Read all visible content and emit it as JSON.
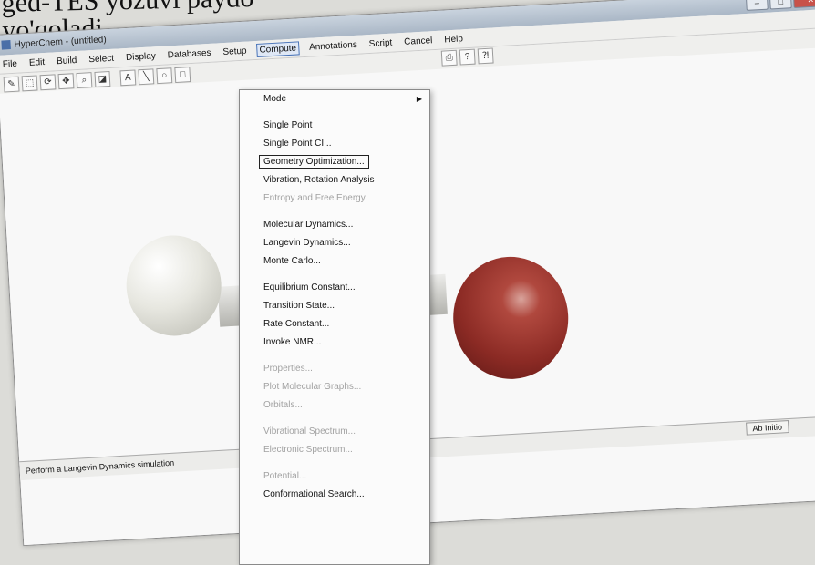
{
  "book_text": {
    "line1": "ged-TES yozuvi paydo",
    "line2": "yo'qoladi."
  },
  "window": {
    "title": "HyperChem - (untitled)"
  },
  "menu": [
    "File",
    "Edit",
    "Build",
    "Select",
    "Display",
    "Databases",
    "Setup",
    "Compute",
    "Annotations",
    "Script",
    "Cancel",
    "Help"
  ],
  "toolbar_icons": [
    "draw-icon",
    "select-icon",
    "rotate-icon",
    "translate-icon",
    "zoom-icon",
    "clip-icon",
    "text-icon",
    "line-icon",
    "ellipse-icon",
    "rectangle-icon"
  ],
  "compute_menu": {
    "mode": "Mode",
    "single_point": "Single Point",
    "single_point_ci": "Single Point CI...",
    "geometry_optimization": "Geometry Optimization...",
    "vibration_rotation": "Vibration, Rotation Analysis",
    "entropy": "Entropy and Free Energy",
    "molecular_dynamics": "Molecular Dynamics...",
    "langevin_dynamics": "Langevin Dynamics...",
    "monte_carlo": "Monte Carlo...",
    "equilibrium_constant": "Equilibrium Constant...",
    "transition_state": "Transition State...",
    "rate_constant": "Rate Constant...",
    "invoke_nmr": "Invoke NMR...",
    "properties": "Properties...",
    "plot_molecular_graphs": "Plot Molecular Graphs...",
    "orbitals": "Orbitals...",
    "vibrational_spectrum": "Vibrational Spectrum...",
    "electronic_spectrum": "Electronic Spectrum...",
    "potential": "Potential...",
    "conformational_search": "Conformational Search..."
  },
  "status": {
    "message": "Perform a Langevin Dynamics simulation",
    "mode": "Ab Initio"
  }
}
